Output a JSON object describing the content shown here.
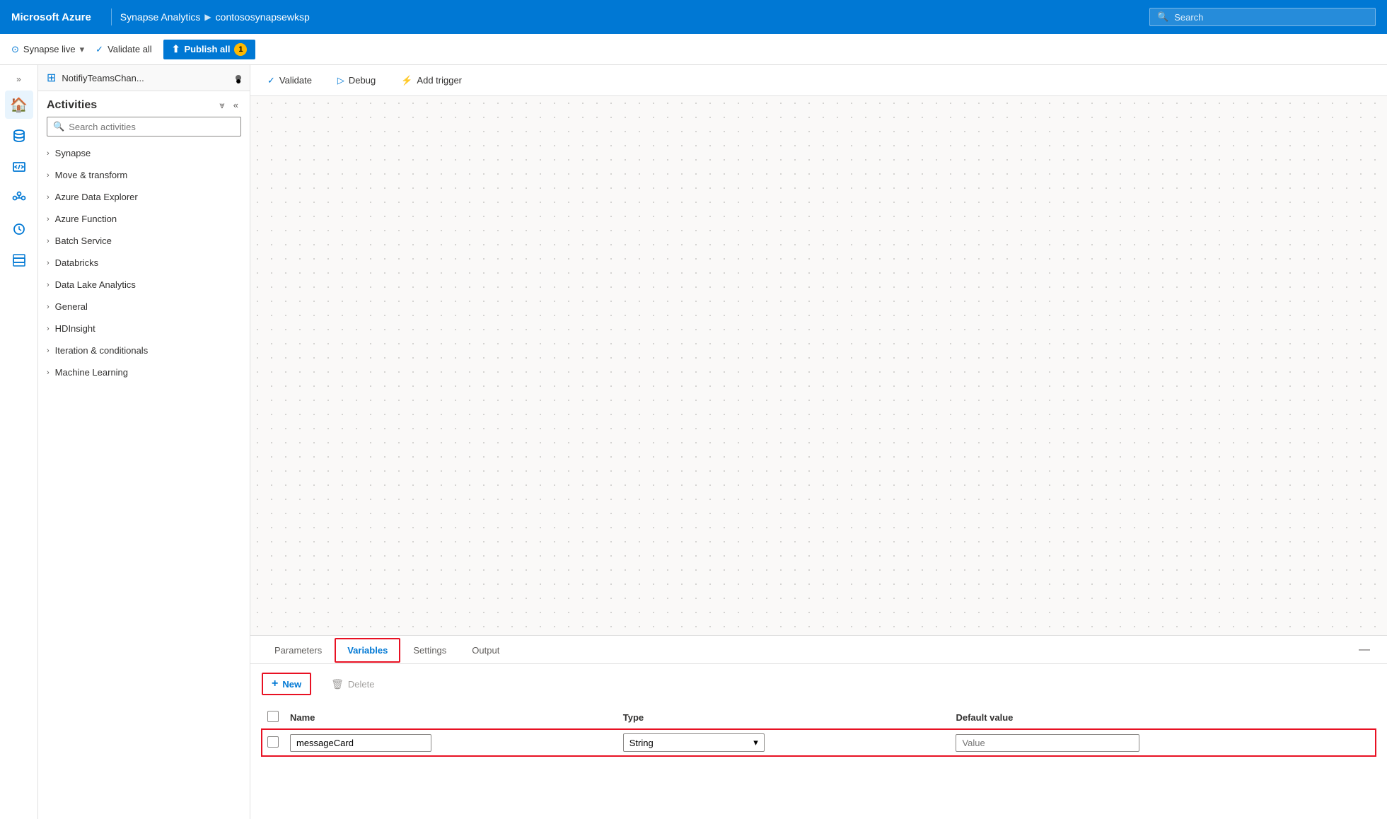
{
  "topbar": {
    "brand": "Microsoft Azure",
    "nav_item1": "Synapse Analytics",
    "nav_arrow": "▶",
    "nav_item2": "contososynapsewksp",
    "search_placeholder": "Search"
  },
  "secondtoolbar": {
    "synapse_live": "Synapse live",
    "validate_all": "Validate all",
    "publish_all": "Publish all",
    "badge": "1"
  },
  "tab": {
    "icon": "⊞",
    "title": "NotifiyTeamsChan...",
    "dot": "●"
  },
  "activities": {
    "title": "Activities",
    "search_placeholder": "Search activities",
    "items": [
      {
        "label": "Synapse"
      },
      {
        "label": "Move & transform"
      },
      {
        "label": "Azure Data Explorer"
      },
      {
        "label": "Azure Function"
      },
      {
        "label": "Batch Service"
      },
      {
        "label": "Databricks"
      },
      {
        "label": "Data Lake Analytics"
      },
      {
        "label": "General"
      },
      {
        "label": "HDInsight"
      },
      {
        "label": "Iteration & conditionals"
      },
      {
        "label": "Machine Learning"
      }
    ]
  },
  "canvas_toolbar": {
    "validate": "Validate",
    "debug": "Debug",
    "add_trigger": "Add trigger"
  },
  "bottom_tabs": {
    "parameters": "Parameters",
    "variables": "Variables",
    "settings": "Settings",
    "output": "Output"
  },
  "variables": {
    "new_label": "New",
    "delete_label": "Delete",
    "col_name": "Name",
    "col_type": "Type",
    "col_default": "Default value",
    "row": {
      "name_value": "messageCard",
      "type_value": "String",
      "default_placeholder": "Value"
    }
  }
}
